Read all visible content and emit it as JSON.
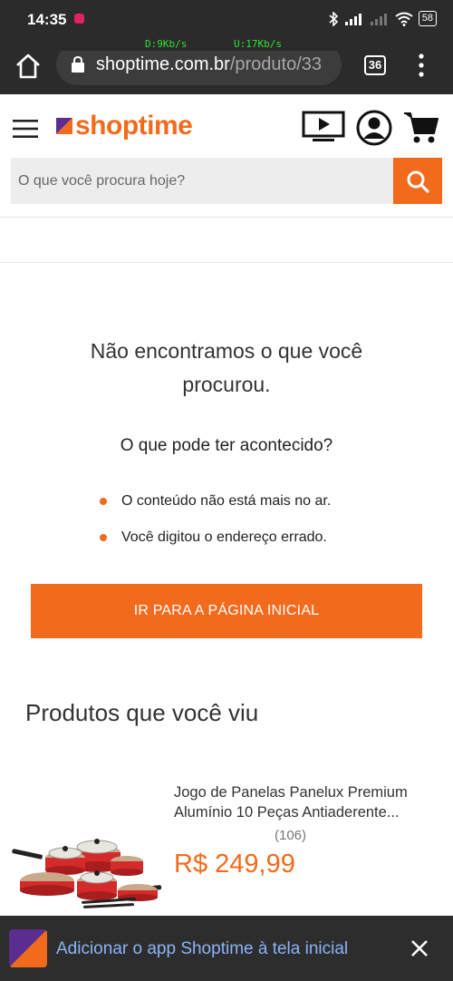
{
  "status_bar": {
    "time": "14:35",
    "battery": "58",
    "net_down": "D:9Kb/s",
    "net_up": "U:17Kb/s"
  },
  "browser": {
    "url_host": "shoptime.com.br",
    "url_path": "/produto/33",
    "tab_count": "36"
  },
  "header": {
    "logo_text": "shoptime",
    "search_placeholder": "O que você procura hoje?"
  },
  "not_found": {
    "title": "Não encontramos o que você procurou.",
    "subtitle": "O que pode ter acontecido?",
    "reasons": [
      "O conteúdo não está mais no ar.",
      "Você digitou o endereço errado."
    ],
    "cta_label": "IR PARA A PÁGINA INICIAL"
  },
  "viewed": {
    "title": "Produtos que você viu",
    "products": [
      {
        "name": "Jogo de Panelas Panelux Premium Alumínio 10 Peças Antiaderente...",
        "reviews": "(106)",
        "price": "R$ 249,99"
      }
    ]
  },
  "install_banner": {
    "text": "Adicionar o app Shoptime à tela inicial"
  },
  "colors": {
    "brand_orange": "#f26b1d",
    "brand_purple": "#5b2d91",
    "browser_dark": "#2b2b2b",
    "link_blue": "#8ab4f8"
  }
}
